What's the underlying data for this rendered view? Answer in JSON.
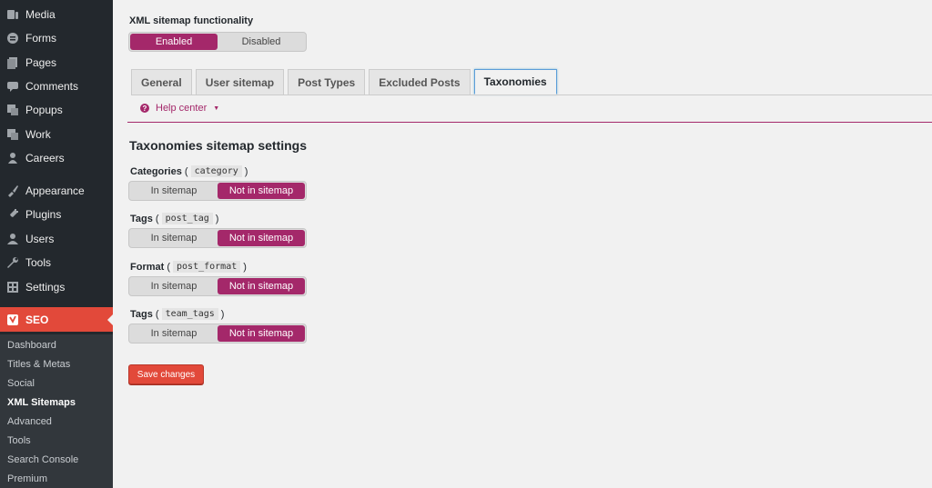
{
  "sidebar": {
    "items": [
      {
        "label": "Media",
        "icon": "media-icon"
      },
      {
        "label": "Forms",
        "icon": "forms-icon"
      },
      {
        "label": "Pages",
        "icon": "pages-icon"
      },
      {
        "label": "Comments",
        "icon": "comments-icon"
      },
      {
        "label": "Popups",
        "icon": "popups-icon"
      },
      {
        "label": "Work",
        "icon": "work-icon"
      },
      {
        "label": "Careers",
        "icon": "careers-icon"
      },
      {
        "label": "Appearance",
        "icon": "appearance-icon"
      },
      {
        "label": "Plugins",
        "icon": "plugins-icon"
      },
      {
        "label": "Users",
        "icon": "users-icon"
      },
      {
        "label": "Tools",
        "icon": "tools-icon"
      },
      {
        "label": "Settings",
        "icon": "settings-icon"
      },
      {
        "label": "SEO",
        "icon": "yoast-icon"
      }
    ],
    "submenu": [
      "Dashboard",
      "Titles & Metas",
      "Social",
      "XML Sitemaps",
      "Advanced",
      "Tools",
      "Search Console",
      "Premium"
    ],
    "current_submenu": "XML Sitemaps"
  },
  "main": {
    "functionality_label": "XML sitemap functionality",
    "functionality_toggle": {
      "on": "Enabled",
      "off": "Disabled",
      "selected": "Enabled"
    },
    "tabs": [
      "General",
      "User sitemap",
      "Post Types",
      "Excluded Posts",
      "Taxonomies"
    ],
    "active_tab": "Taxonomies",
    "help_center": "Help center",
    "section_title": "Taxonomies sitemap settings",
    "taxonomies": [
      {
        "name": "Categories",
        "slug": "category",
        "selected": "Not in sitemap"
      },
      {
        "name": "Tags",
        "slug": "post_tag",
        "selected": "Not in sitemap"
      },
      {
        "name": "Format",
        "slug": "post_format",
        "selected": "Not in sitemap"
      },
      {
        "name": "Tags",
        "slug": "team_tags",
        "selected": "Not in sitemap"
      }
    ],
    "option_in": "In sitemap",
    "option_out": "Not in sitemap",
    "paren_open": "(",
    "paren_close": ")",
    "save_label": "Save changes"
  },
  "colors": {
    "accent": "#a4286a",
    "sidebar_bg": "#23282d",
    "seo_active": "#e2493a",
    "save_button": "#e2493a"
  }
}
